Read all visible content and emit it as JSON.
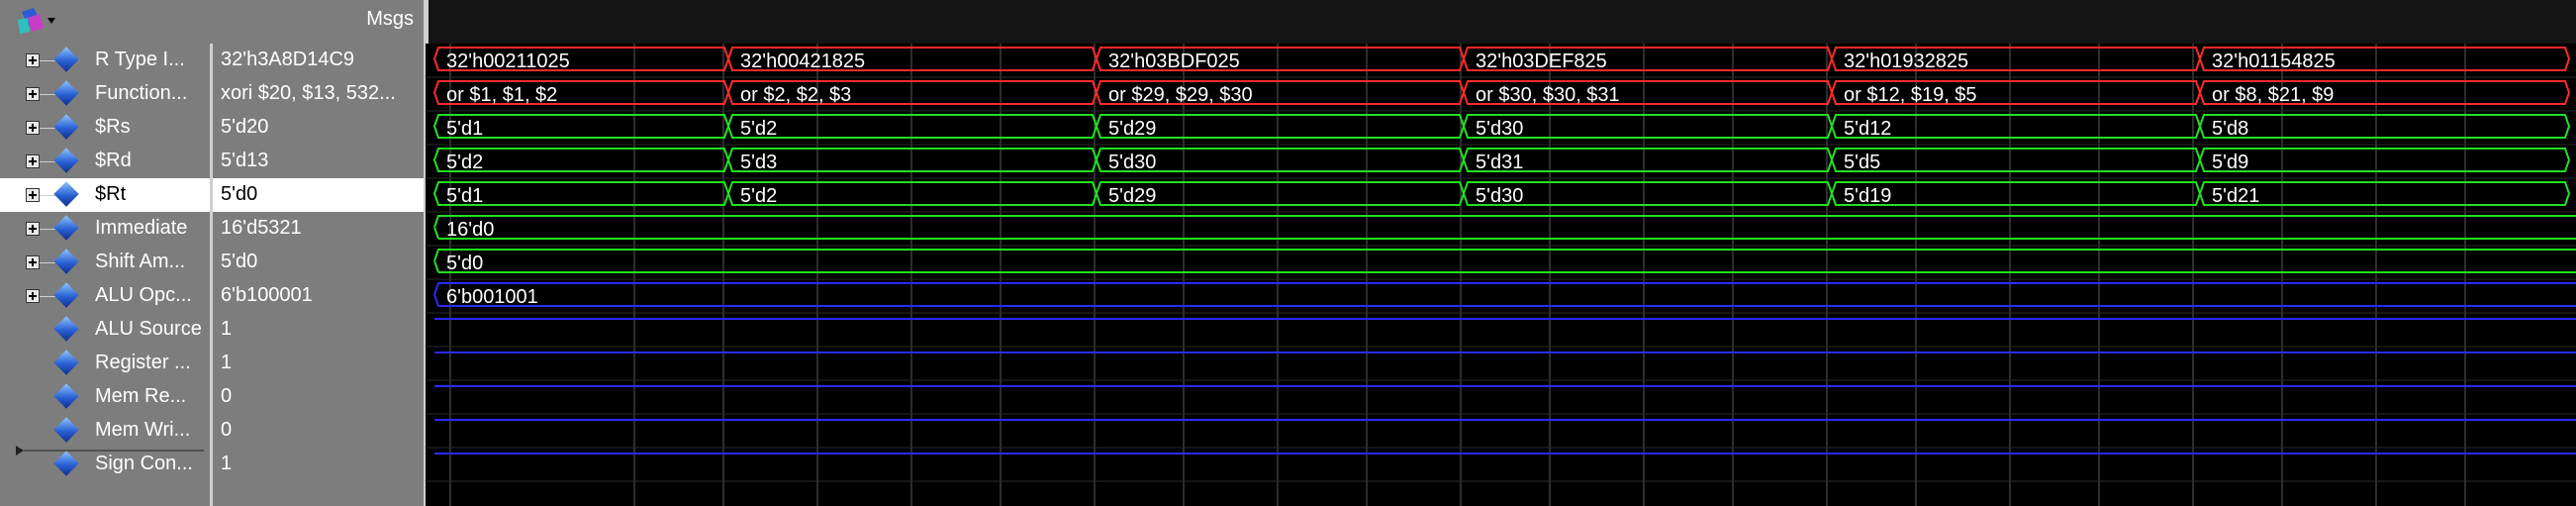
{
  "header": {
    "msgs_label": "Msgs",
    "logo_icon": "wave-logo-icon"
  },
  "colors": {
    "bus_red": "#ff2a2a",
    "bus_green": "#22e022",
    "bus_blue": "#2a2aff",
    "grid": "#5a5a5a"
  },
  "signals": [
    {
      "id": "r-type",
      "name": "R Type I...",
      "value": "32'h3A8D14C9",
      "expandable": true,
      "selected": false
    },
    {
      "id": "function",
      "name": "Function...",
      "value": "xori $20, $13, 532...",
      "expandable": true,
      "selected": false
    },
    {
      "id": "rs",
      "name": "$Rs",
      "value": "5'd20",
      "expandable": true,
      "selected": false
    },
    {
      "id": "rd",
      "name": "$Rd",
      "value": "5'd13",
      "expandable": true,
      "selected": false
    },
    {
      "id": "rt",
      "name": "$Rt",
      "value": "5'd0",
      "expandable": true,
      "selected": true
    },
    {
      "id": "immediate",
      "name": "Immediate",
      "value": "16'd5321",
      "expandable": true,
      "selected": false
    },
    {
      "id": "shift",
      "name": "Shift Am...",
      "value": "5'd0",
      "expandable": true,
      "selected": false
    },
    {
      "id": "aluop",
      "name": "ALU Opc...",
      "value": "6'b100001",
      "expandable": true,
      "selected": false
    },
    {
      "id": "alusrc",
      "name": "ALU Source",
      "value": "1",
      "expandable": false,
      "selected": false
    },
    {
      "id": "regwrite",
      "name": "Register ...",
      "value": "1",
      "expandable": false,
      "selected": false
    },
    {
      "id": "memread",
      "name": "Mem Re...",
      "value": "0",
      "expandable": false,
      "selected": false
    },
    {
      "id": "memwrite",
      "name": "Mem Wri...",
      "value": "0",
      "expandable": false,
      "selected": false
    },
    {
      "id": "signcon",
      "name": "Sign Con...",
      "value": "1",
      "expandable": false,
      "selected": false
    }
  ],
  "waves": [
    {
      "row": 0,
      "color": "red",
      "labels": [
        "32'h00211025",
        "32'h00421825",
        "32'h03BDF025",
        "32'h03DEF825",
        "32'h01932825",
        "32'h01154825"
      ]
    },
    {
      "row": 1,
      "color": "red",
      "labels": [
        "or $1, $1, $2",
        "or $2, $2, $3",
        "or $29, $29, $30",
        "or $30, $30, $31",
        "or $12, $19, $5",
        "or $8, $21, $9"
      ]
    },
    {
      "row": 2,
      "color": "green",
      "labels": [
        "5'd1",
        "5'd2",
        "5'd29",
        "5'd30",
        "5'd12",
        "5'd8"
      ]
    },
    {
      "row": 3,
      "color": "green",
      "labels": [
        "5'd2",
        "5'd3",
        "5'd30",
        "5'd31",
        "5'd5",
        "5'd9"
      ]
    },
    {
      "row": 4,
      "color": "green",
      "labels": [
        "5'd1",
        "5'd2",
        "5'd29",
        "5'd30",
        "5'd19",
        "5'd21"
      ]
    },
    {
      "row": 5,
      "color": "green",
      "labels": [
        "16'd0"
      ]
    },
    {
      "row": 6,
      "color": "green",
      "labels": [
        "5'd0"
      ]
    },
    {
      "row": 7,
      "color": "blue",
      "labels": [
        "6'b001001"
      ]
    },
    {
      "row": 8,
      "color": "blue",
      "labels": []
    },
    {
      "row": 9,
      "color": "blue",
      "labels": []
    },
    {
      "row": 10,
      "color": "blue",
      "labels": []
    },
    {
      "row": 11,
      "color": "blue",
      "labels": []
    },
    {
      "row": 12,
      "color": "blue",
      "labels": []
    }
  ]
}
